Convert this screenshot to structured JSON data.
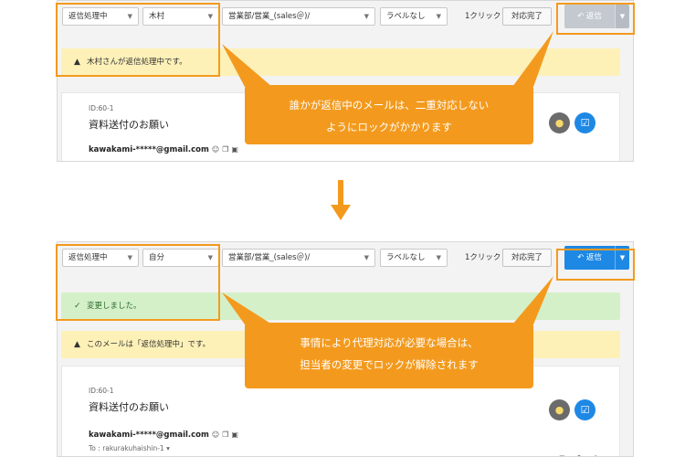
{
  "before": {
    "toolbar": {
      "status_select": "返信処理中",
      "assignee_select": "木村",
      "mailbox_select": "営業部/営業_(sales＠)/",
      "label_select": "ラベルなし",
      "click_label": "1クリック",
      "done_button": "対応完了",
      "reply_button": "返信",
      "reply_state": "disabled"
    },
    "alert": "木村さんが返信処理中です。",
    "message": {
      "id": "ID:60-1",
      "subject": "資料送付のお願い",
      "from": "kawakami-*****@gmail.com"
    },
    "callout_lines": [
      "誰かが返信中のメールは、二重対応しない",
      "ようにロックがかかります"
    ]
  },
  "after": {
    "toolbar": {
      "status_select": "返信処理中",
      "assignee_select": "自分",
      "mailbox_select": "営業部/営業_(sales＠)/",
      "label_select": "ラベルなし",
      "click_label": "1クリック",
      "done_button": "対応完了",
      "reply_button": "返信",
      "reply_state": "enabled"
    },
    "success_alert": "変更しました。",
    "alert": "このメールは「返信処理中」です。",
    "message": {
      "id": "ID:60-1",
      "subject": "資料送付のお願い",
      "from": "kawakami-*****@gmail.com",
      "to": "To : rakurakuhaishin-1"
    },
    "callout_lines": [
      "事情により代理対応が必要な場合は、",
      "担当者の変更でロックが解除されます"
    ]
  },
  "icons": {
    "caret": "chevron-down-icon",
    "warning": "warning-icon",
    "check": "check-icon",
    "reply": "reply-arrow-icon",
    "chat": "chat-bubble-icon",
    "checkbox": "checkbox-icon",
    "arrow": "down-arrow-icon"
  },
  "colors": {
    "highlight": "#f39a1e",
    "reply_active": "#1e88e5",
    "reply_disabled": "#c4c9d0",
    "warn_bg": "#fdf1b8",
    "ok_bg": "#d4f0c9"
  }
}
